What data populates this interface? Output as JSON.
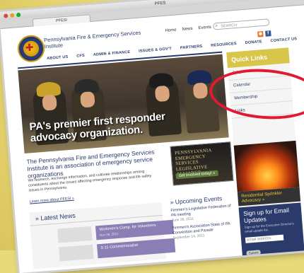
{
  "browser": {
    "window_title": "PFES",
    "tab_label": "PFESI"
  },
  "header": {
    "org_name": "Pennsylvania Fire & Emergency Services Institute",
    "top_links": [
      "Home",
      "News",
      "Events"
    ],
    "search_placeholder": "SEARCH",
    "social": [
      "rss",
      "f"
    ]
  },
  "nav": [
    "ABOUT US",
    "CFS",
    "ADMIN & FINANCE",
    "ISSUES & GOV'T",
    "PARTNERS",
    "RESOURCES",
    "DONATE",
    "CONTACT US"
  ],
  "hero": {
    "caption_line1": "PA's premier first responder",
    "caption_line2": "advocacy organization."
  },
  "intro": {
    "title": "The Pennsylvania Fire and Emergency Services Institute is an association of emergency service organizations",
    "body": "We research, exchange information, and cultivate relationships among constituents about the issues affecting emergency response and life safety issues in Pennsylvania.",
    "link": "Learn more about PFESI »"
  },
  "alliance": {
    "text": "PENNSYLVANIA EMERGENCY SERVICES LEGISLATIVE ALLIANCE",
    "button": "Get involved today! »"
  },
  "latest_news": {
    "title": "» Latest News",
    "items": [
      {
        "title": "Workmen's Comp. for Volunteers",
        "date": "Nov 08, 2011"
      },
      {
        "title": "S-11 Commemorative",
        "date": ""
      }
    ]
  },
  "events": {
    "title": "» Upcoming Events",
    "items": [
      {
        "title": "Firemen's Legislative Federation of PA meeting",
        "date": "June 28, 2011"
      },
      {
        "title": "Firemen's Association State of PA Convention and Parade",
        "date": "September 14, 2011"
      }
    ]
  },
  "sidebar": {
    "heading": "Quick Links",
    "items": [
      "Jobs",
      "Calendar",
      "Membership",
      "Links"
    ],
    "fire_caption": "Residential Sprinkler Advocacy »",
    "signup_title": "Sign up for Email Updates",
    "signup_note": "Sign up for the Executive Director's email update list.",
    "signup_placeholder": "email address",
    "signup_button": "Submit"
  },
  "colors": {
    "accent_navy": "#2a3a6b",
    "accent_gold": "#d8c64a",
    "annotation_red": "#e21932",
    "news_purple": "#8a7eb5"
  }
}
